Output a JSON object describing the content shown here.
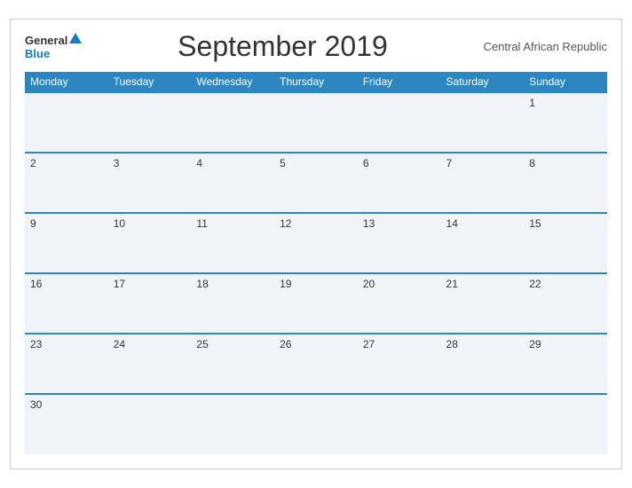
{
  "header": {
    "logo_general": "General",
    "logo_blue": "Blue",
    "title": "September 2019",
    "region": "Central African Republic"
  },
  "weekdays": [
    "Monday",
    "Tuesday",
    "Wednesday",
    "Thursday",
    "Friday",
    "Saturday",
    "Sunday"
  ],
  "weeks": [
    [
      "",
      "",
      "",
      "",
      "",
      "",
      "1"
    ],
    [
      "2",
      "3",
      "4",
      "5",
      "6",
      "7",
      "8"
    ],
    [
      "9",
      "10",
      "11",
      "12",
      "13",
      "14",
      "15"
    ],
    [
      "16",
      "17",
      "18",
      "19",
      "20",
      "21",
      "22"
    ],
    [
      "23",
      "24",
      "25",
      "26",
      "27",
      "28",
      "29"
    ],
    [
      "30",
      "",
      "",
      "",
      "",
      "",
      ""
    ]
  ]
}
